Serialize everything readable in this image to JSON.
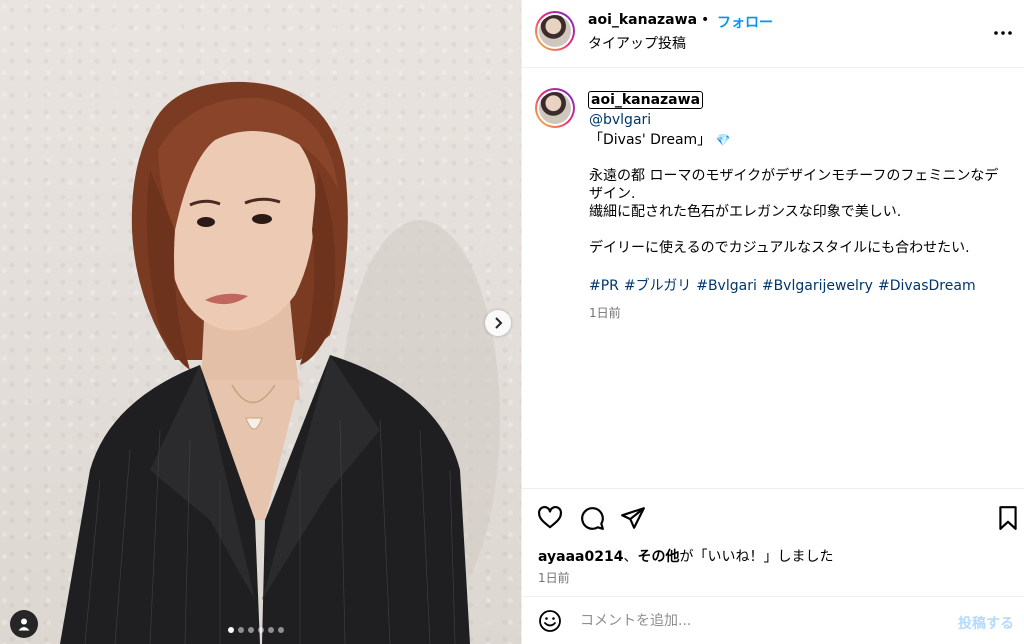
{
  "post": {
    "username": "aoi_kanazawa",
    "separator": "•",
    "follow_label": "フォロー",
    "subtitle": "タイアップ投稿",
    "more_label": "…"
  },
  "caption": {
    "username": "aoi_kanazawa",
    "mention": "@bvlgari",
    "line1": "「Divas' Dream」",
    "gem_emoji": "💎",
    "line2": "永遠の都 ローマのモザイクがデザインモチーフのフェミニンなデ",
    "line3": "ザイン.",
    "line4": "繊細に配された色石がエレガンスな印象で美しい.",
    "line5": "デイリーに使えるのでカジュアルなスタイルにも合わせたい.",
    "hashtags": [
      "#PR",
      "#ブルガリ",
      "#Bvlgari",
      "#Bvlgarijewelry",
      "#DivasDream"
    ],
    "time": "1日前"
  },
  "actions": {
    "likes_user": "ayaaa0214",
    "likes_sep": "、",
    "likes_others": "その他",
    "likes_suffix": "が「いいね！」しました",
    "time": "1日前"
  },
  "comment": {
    "placeholder": "コメントを追加...",
    "post_label": "投稿する"
  },
  "carousel": {
    "slide_count": 6,
    "active_index": 0
  },
  "colors": {
    "accent": "#0095f6",
    "link": "#00376b",
    "muted": "#737373",
    "post_disabled": "#b3dbff"
  }
}
